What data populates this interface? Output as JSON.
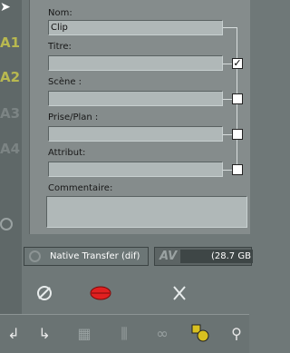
{
  "form": {
    "nom_label": "Nom:",
    "nom_value": "Clip",
    "titre_label": "Titre:",
    "titre_value": "",
    "titre_checked": true,
    "scene_label": "Scène :",
    "scene_value": "",
    "scene_checked": false,
    "prise_label": "Prise/Plan :",
    "prise_value": "",
    "prise_checked": false,
    "attribut_label": "Attribut:",
    "attribut_value": "",
    "attribut_checked": false,
    "commentaire_label": "Commentaire:",
    "checkmark": "✓"
  },
  "status": {
    "transfer_label": "Native Transfer (dif)",
    "av_label": "AV",
    "free_space": "(28.7 GB"
  },
  "track_markers": [
    "A1",
    "A2",
    "A3",
    "A4"
  ],
  "colors": {
    "record_red": "#e02020",
    "track_yellow": "#c8c860",
    "panel": "#858c8c"
  }
}
